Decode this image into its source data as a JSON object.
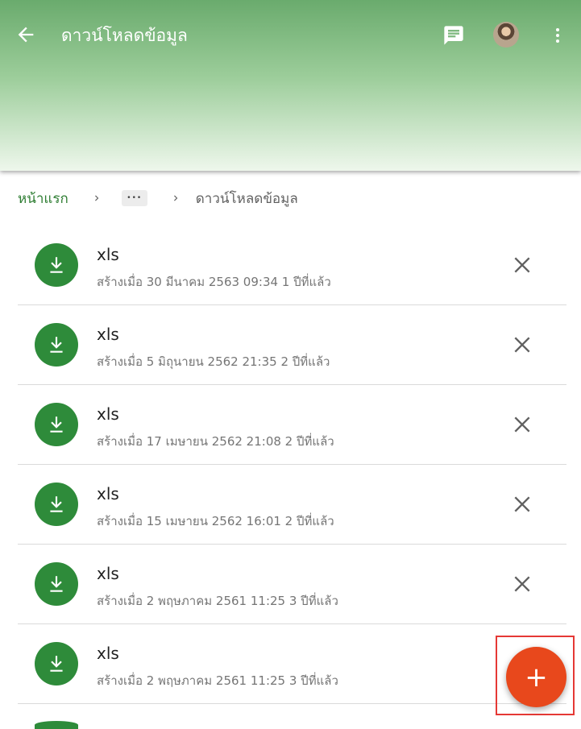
{
  "appbar": {
    "title": "ดาวน์โหลดข้อมูล",
    "icons": {
      "back": "arrow-back-icon",
      "chat": "chat-icon",
      "more": "more-vert-icon"
    }
  },
  "breadcrumb": {
    "home": "หน้าแรก",
    "more": "•••",
    "current": "ดาวน์โหลดข้อมูล"
  },
  "files": [
    {
      "name": "xls",
      "meta": "สร้างเมื่อ 30 มีนาคม 2563 09:34 1 ปีที่แล้ว"
    },
    {
      "name": "xls",
      "meta": "สร้างเมื่อ 5 มิถุนายน 2562 21:35 2 ปีที่แล้ว"
    },
    {
      "name": "xls",
      "meta": "สร้างเมื่อ 17 เมษายน 2562 21:08 2 ปีที่แล้ว"
    },
    {
      "name": "xls",
      "meta": "สร้างเมื่อ 15 เมษายน 2562 16:01 2 ปีที่แล้ว"
    },
    {
      "name": "xls",
      "meta": "สร้างเมื่อ 2 พฤษภาคม 2561 11:25 3 ปีที่แล้ว"
    },
    {
      "name": "xls",
      "meta": "สร้างเมื่อ 2 พฤษภาคม 2561 11:25 3 ปีที่แล้ว"
    }
  ],
  "fab": {
    "label": "+"
  },
  "colors": {
    "accent_green": "#2e8b3a",
    "fab_orange": "#e8481c",
    "highlight_red": "#e53935"
  }
}
